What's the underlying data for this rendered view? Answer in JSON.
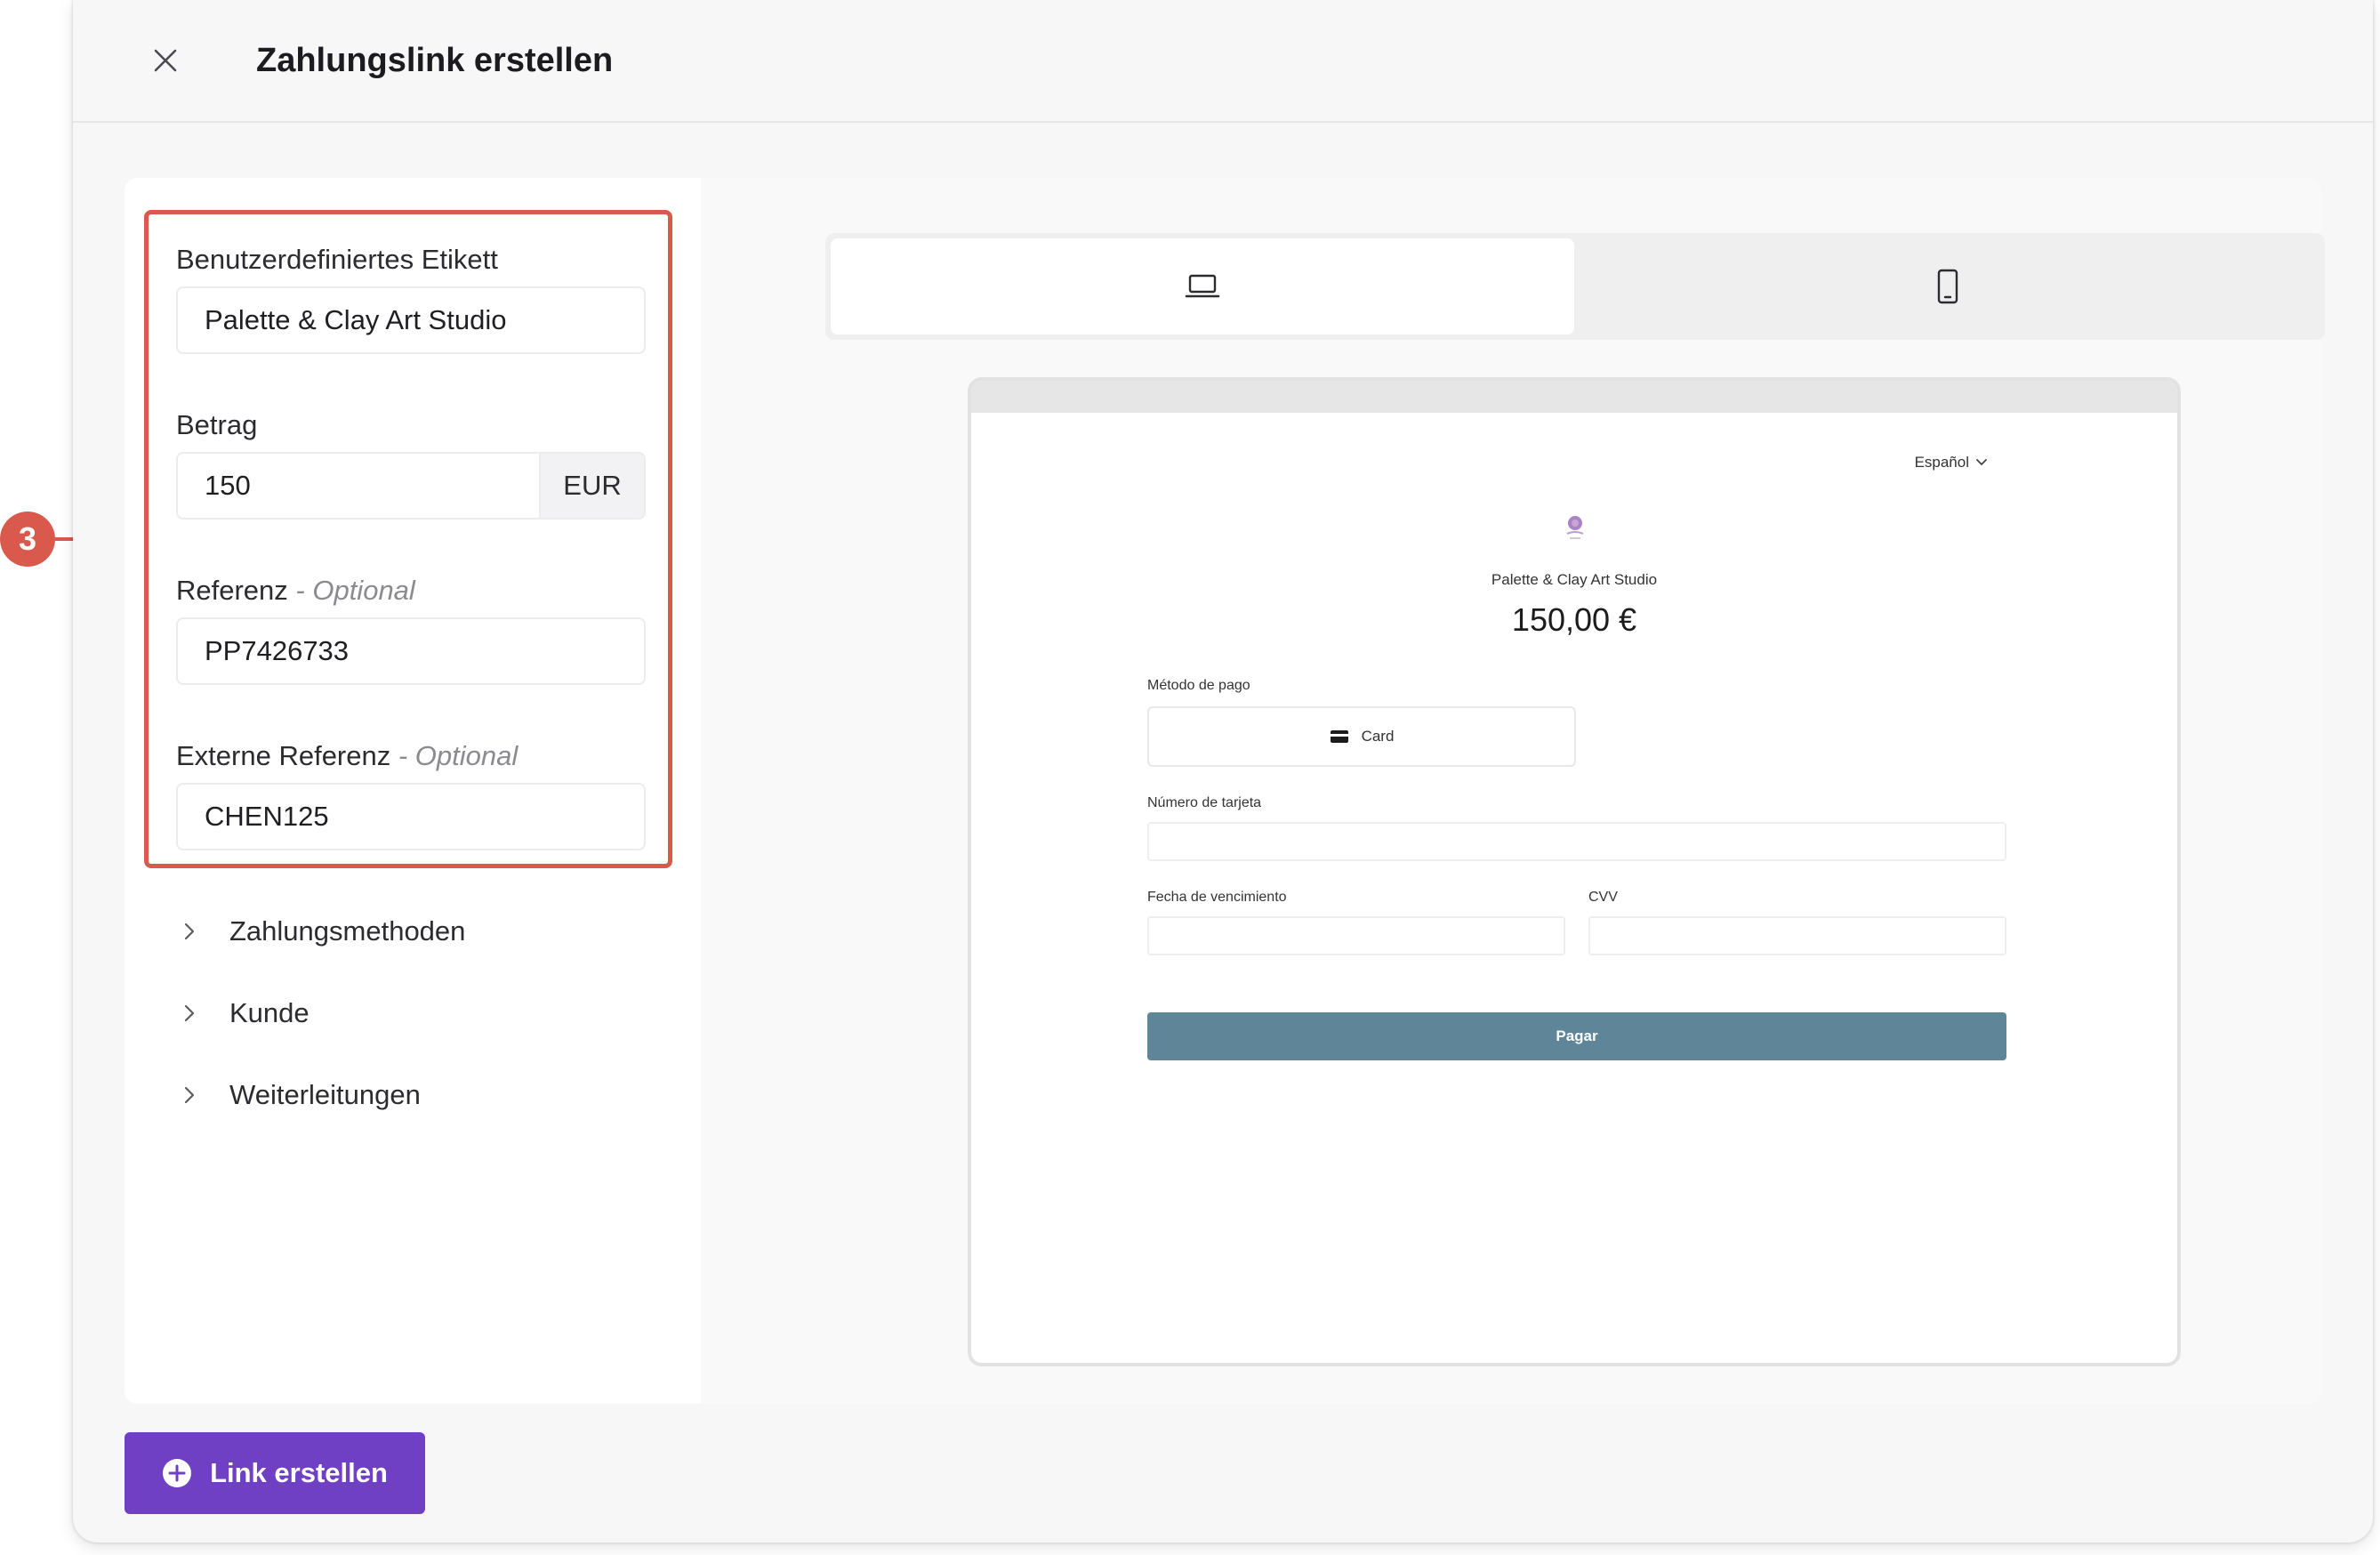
{
  "modal": {
    "title": "Zahlungslink erstellen",
    "close_icon": "close-icon"
  },
  "form": {
    "label_field": {
      "label": "Benutzerdefiniertes Etikett",
      "value": "Palette & Clay Art Studio"
    },
    "amount_field": {
      "label": "Betrag",
      "value": "150",
      "currency": "EUR"
    },
    "reference_field": {
      "label": "Referenz",
      "optional": " - Optional",
      "value": "PP7426733"
    },
    "external_reference_field": {
      "label": "Externe Referenz",
      "optional": " - Optional",
      "value": "CHEN125"
    }
  },
  "accordion": [
    {
      "label": "Zahlungsmethoden",
      "icon": "chevron-right-icon"
    },
    {
      "label": "Kunde",
      "icon": "chevron-right-icon"
    },
    {
      "label": "Weiterleitungen",
      "icon": "chevron-right-icon"
    }
  ],
  "device_switch": {
    "desktop_icon": "laptop-icon",
    "mobile_icon": "smartphone-icon",
    "active": "desktop"
  },
  "preview": {
    "language": "Español",
    "merchant_name": "Palette & Clay Art Studio",
    "amount": "150,00 €",
    "payment_method_label": "Método de pago",
    "payment_method_option": "Card",
    "card_number_label": "Número de tarjeta",
    "expiry_label": "Fecha de vencimiento",
    "cvv_label": "CVV",
    "pay_button": "Pagar"
  },
  "footer": {
    "create_button": "Link erstellen",
    "create_icon": "plus-circle-icon"
  },
  "callout": {
    "number": "3",
    "color": "#d9594c"
  },
  "colors": {
    "primary": "#6f3fc4",
    "highlight": "#d9594c",
    "preview_pay": "#5e8698"
  }
}
